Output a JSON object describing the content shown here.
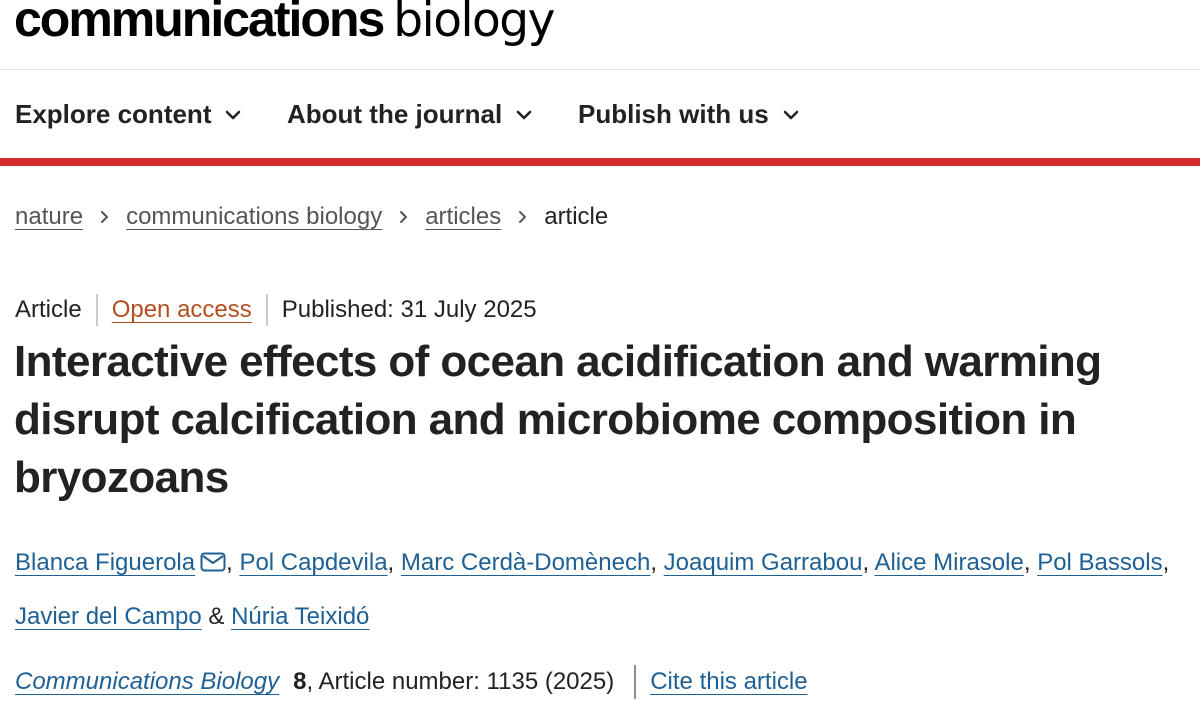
{
  "masthead": {
    "logo_primary": "communications",
    "logo_secondary": "biology"
  },
  "nav": {
    "items": [
      {
        "label": "Explore content"
      },
      {
        "label": "About the journal"
      },
      {
        "label": "Publish with us"
      }
    ],
    "accent_color": "#d52b2b"
  },
  "breadcrumb": {
    "items": [
      "nature",
      "communications biology",
      "articles"
    ],
    "current": "article"
  },
  "article": {
    "type": "Article",
    "access": "Open access",
    "published": "Published: 31 July 2025",
    "title": "Interactive effects of ocean acidification and warming disrupt calcification and microbiome composition in bryozoans",
    "authors": [
      "Blanca Figuerola",
      "Pol Capdevila",
      "Marc Cerdà-Domènech",
      "Joaquim Garrabou",
      "Alice Mirasole",
      "Pol Bassols",
      "Javier del Campo",
      "Núria Teixidó"
    ],
    "author_separator": ", ",
    "author_final_separator": " & ",
    "journal": "Communications Biology",
    "volume": "8",
    "article_number": ", Article number: 1135 (2025)",
    "cite_label": "Cite this article"
  },
  "icons": {
    "nav_chevron": "chevron-down-icon",
    "breadcrumb_separator": "chevron-right-icon",
    "corresponding_author": "mail-icon"
  },
  "colors": {
    "link": "#1e5f94",
    "open_access": "#b44e21",
    "text": "#222222"
  }
}
